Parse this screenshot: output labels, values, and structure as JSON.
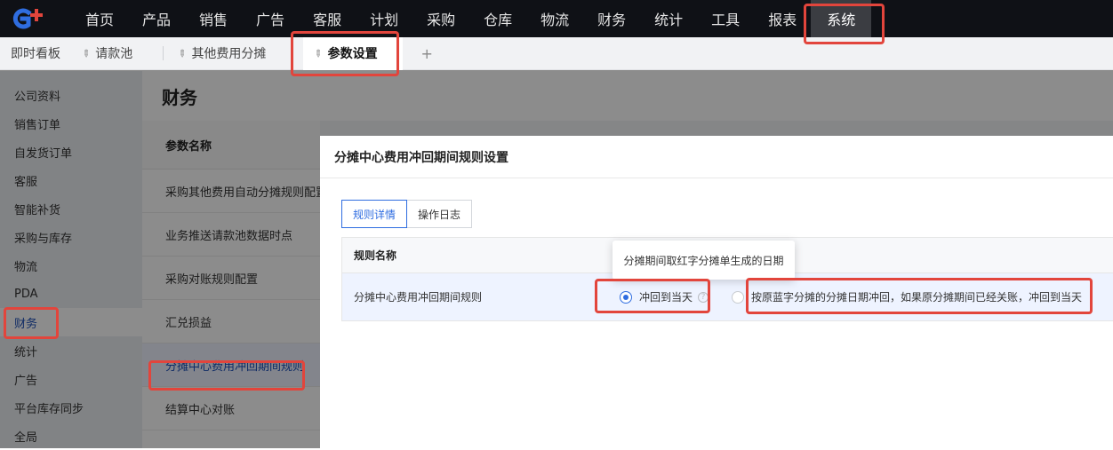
{
  "nav": {
    "logo_text": "G+",
    "items": [
      "首页",
      "产品",
      "销售",
      "广告",
      "客服",
      "计划",
      "采购",
      "仓库",
      "物流",
      "财务",
      "统计",
      "工具",
      "报表",
      "系统"
    ],
    "active_index": 13
  },
  "tabs": {
    "items": [
      {
        "label": "即时看板",
        "pinned": false
      },
      {
        "label": "请款池",
        "pinned": true
      },
      {
        "label": "其他费用分摊",
        "pinned": true
      },
      {
        "label": "参数设置",
        "pinned": true
      }
    ],
    "active_index": 3,
    "add_label": "+"
  },
  "sidebar": {
    "items": [
      "公司资料",
      "销售订单",
      "自发货订单",
      "客服",
      "智能补货",
      "采购与库存",
      "物流",
      "PDA",
      "财务",
      "统计",
      "广告",
      "平台库存同步",
      "全局"
    ],
    "active_index": 8
  },
  "main": {
    "title": "财务",
    "param_header": "参数名称",
    "params": [
      "采购其他费用自动分摊规则配置",
      "业务推送请款池数据时点",
      "采购对账规则配置",
      "汇兑损益",
      "分摊中心费用冲回期间规则",
      "结算中心对账"
    ],
    "active_param_index": 4
  },
  "drawer": {
    "title": "分摊中心费用冲回期间规则设置",
    "segments": [
      "规则详情",
      "操作日志"
    ],
    "active_segment": 0,
    "table": {
      "header": "规则名称",
      "rule_name": "分摊中心费用冲回期间规则",
      "options": [
        {
          "label": "冲回到当天",
          "selected": true
        },
        {
          "label": "按原蓝字分摊的分摊日期冲回，如果原分摊期间已经关账，冲回到当天",
          "selected": false
        }
      ],
      "help_glyph": "?"
    },
    "tooltip": "分摊期间取红字分摊单生成的日期"
  },
  "colors": {
    "accent": "#2f6de0",
    "highlight": "#e2453c",
    "nav_bg": "#0f1116"
  }
}
